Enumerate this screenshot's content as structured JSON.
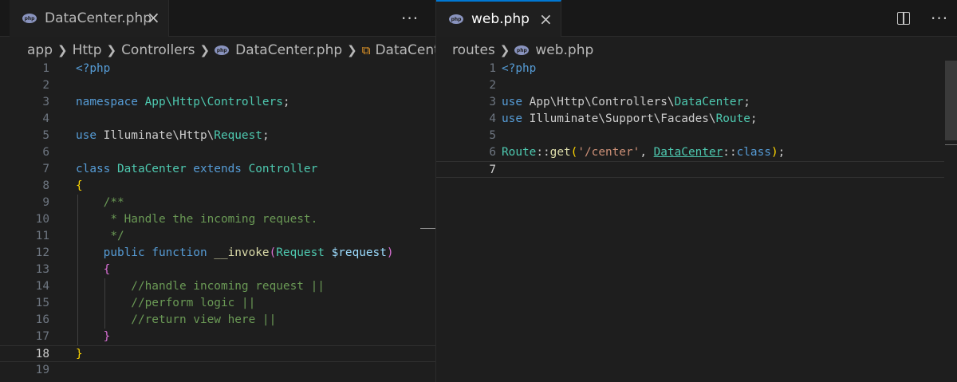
{
  "left_pane": {
    "tab": {
      "label": "DataCenter.php",
      "file_icon": "php-file-icon",
      "close_glyph": "×"
    },
    "more_actions_glyph": "···",
    "breadcrumb": [
      "app",
      "Http",
      "Controllers",
      "DataCenter.php",
      "DataCenter"
    ],
    "lines": [
      [
        {
          "t": "<?php",
          "c": "tag"
        }
      ],
      [],
      [
        {
          "t": "namespace ",
          "c": "kw"
        },
        {
          "t": "App\\Http\\Controllers",
          "c": "cls"
        },
        {
          "t": ";",
          "c": "pn"
        }
      ],
      [],
      [
        {
          "t": "use ",
          "c": "kw"
        },
        {
          "t": "Illuminate\\Http\\",
          "c": "pn"
        },
        {
          "t": "Request",
          "c": "cls"
        },
        {
          "t": ";",
          "c": "pn"
        }
      ],
      [],
      [
        {
          "t": "class ",
          "c": "kw"
        },
        {
          "t": "DataCenter ",
          "c": "cls"
        },
        {
          "t": "extends ",
          "c": "kw"
        },
        {
          "t": "Controller",
          "c": "cls"
        }
      ],
      [
        {
          "t": "{",
          "c": "br1"
        }
      ],
      [
        {
          "t": "    /**",
          "c": "cmt"
        }
      ],
      [
        {
          "t": "     * Handle the incoming request.",
          "c": "cmt"
        }
      ],
      [
        {
          "t": "     */",
          "c": "cmt"
        }
      ],
      [
        {
          "t": "    ",
          "c": "pn"
        },
        {
          "t": "public function ",
          "c": "kw"
        },
        {
          "t": "__invoke",
          "c": "fn"
        },
        {
          "t": "(",
          "c": "br2"
        },
        {
          "t": "Request ",
          "c": "cls"
        },
        {
          "t": "$request",
          "c": "var"
        },
        {
          "t": ")",
          "c": "br2"
        }
      ],
      [
        {
          "t": "    ",
          "c": "pn"
        },
        {
          "t": "{",
          "c": "br2"
        }
      ],
      [
        {
          "t": "        //handle incoming request ||",
          "c": "cmt"
        }
      ],
      [
        {
          "t": "        //perform logic ||",
          "c": "cmt"
        }
      ],
      [
        {
          "t": "        //return view here ||",
          "c": "cmt"
        }
      ],
      [
        {
          "t": "    ",
          "c": "pn"
        },
        {
          "t": "}",
          "c": "br2"
        }
      ],
      [
        {
          "t": "}",
          "c": "br1"
        }
      ],
      []
    ],
    "active_line": 18
  },
  "right_pane": {
    "tab": {
      "label": "web.php",
      "file_icon": "php-file-icon",
      "close_glyph": "×"
    },
    "split_editor_icon": "split-editor-icon",
    "more_actions_glyph": "···",
    "breadcrumb": [
      "routes",
      "web.php"
    ],
    "lines": [
      [
        {
          "t": "<?php",
          "c": "tag"
        }
      ],
      [],
      [
        {
          "t": "use ",
          "c": "kw"
        },
        {
          "t": "App\\Http\\Controllers\\",
          "c": "pn"
        },
        {
          "t": "DataCenter",
          "c": "cls"
        },
        {
          "t": ";",
          "c": "pn"
        }
      ],
      [
        {
          "t": "use ",
          "c": "kw"
        },
        {
          "t": "Illuminate\\Support\\Facades\\",
          "c": "pn"
        },
        {
          "t": "Route",
          "c": "cls"
        },
        {
          "t": ";",
          "c": "pn"
        }
      ],
      [],
      [
        {
          "t": "Route",
          "c": "cls"
        },
        {
          "t": "::",
          "c": "pn"
        },
        {
          "t": "get",
          "c": "fn"
        },
        {
          "t": "(",
          "c": "br1"
        },
        {
          "t": "'/center'",
          "c": "str"
        },
        {
          "t": ", ",
          "c": "pn"
        },
        {
          "t": "DataCenter",
          "c": "cls ul"
        },
        {
          "t": "::",
          "c": "pn"
        },
        {
          "t": "class",
          "c": "kw"
        },
        {
          "t": ")",
          "c": "br1"
        },
        {
          "t": ";",
          "c": "pn"
        }
      ],
      []
    ],
    "active_line": 7
  },
  "colors": {
    "background": "#1e1e1e",
    "tab_active_border": "#0078d4",
    "keyword": "#569cd6",
    "class": "#4ec9b0",
    "function": "#dcdcaa",
    "variable": "#9cdcfe",
    "string": "#ce9178",
    "comment": "#6a9955"
  }
}
